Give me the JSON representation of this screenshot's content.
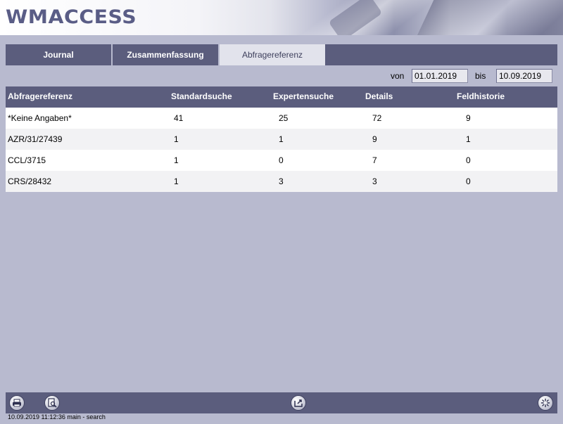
{
  "header": {
    "logo_text": "WMACCESS"
  },
  "tabs": [
    {
      "label": "Journal",
      "active": false
    },
    {
      "label": "Zusammenfassung",
      "active": false
    },
    {
      "label": "Abfragereferenz",
      "active": true
    }
  ],
  "date_range": {
    "from_label": "von",
    "from_value": "01.01.2019",
    "to_label": "bis",
    "to_value": "10.09.2019"
  },
  "table": {
    "columns": [
      "Abfragereferenz",
      "Standardsuche",
      "Expertensuche",
      "Details",
      "Feldhistorie"
    ],
    "rows": [
      [
        "*Keine Angaben*",
        "41",
        "25",
        "72",
        "9"
      ],
      [
        "AZR/31/27439",
        "1",
        "1",
        "9",
        "1"
      ],
      [
        "CCL/3715",
        "1",
        "0",
        "7",
        "0"
      ],
      [
        "CRS/28432",
        "1",
        "3",
        "3",
        "0"
      ]
    ]
  },
  "footer": {
    "icons": [
      "print-icon",
      "print-preview-icon",
      "export-icon",
      "loading-spinner-icon"
    ]
  },
  "status_bar": {
    "text": "10.09.2019 11:12:36 main - search"
  },
  "colors": {
    "accent": "#5b5d7d",
    "background": "#b8bacf",
    "active_tab": "#e2e3ec",
    "logo": "#5a5d86"
  }
}
